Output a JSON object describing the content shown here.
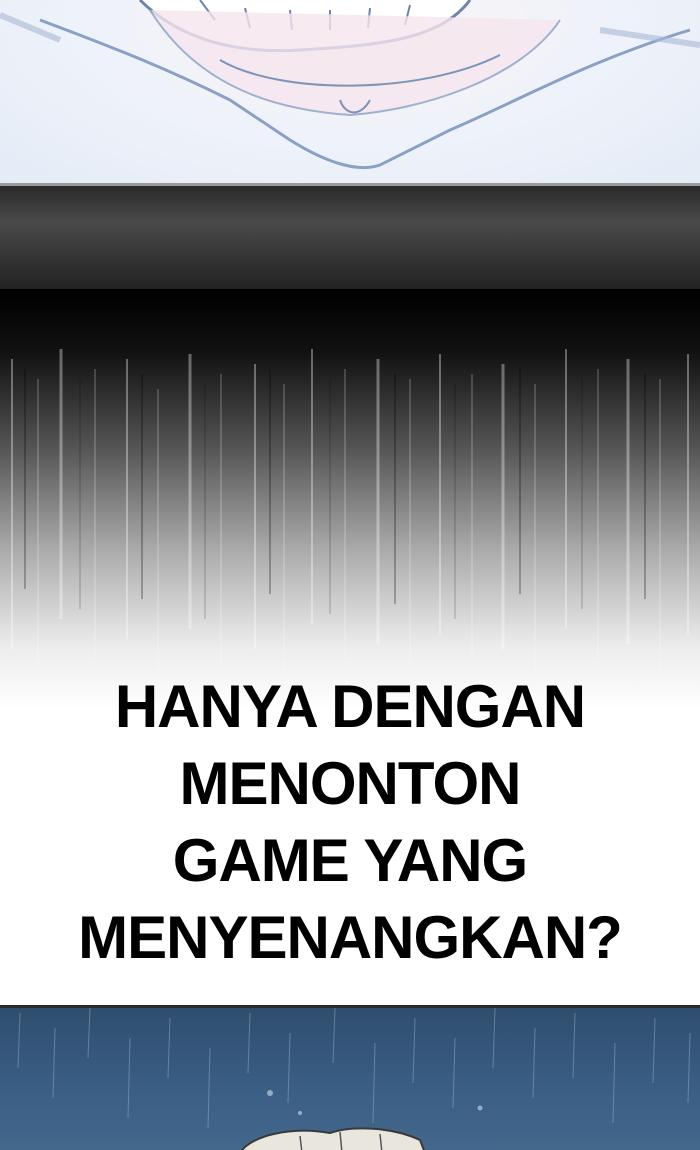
{
  "caption": {
    "lines": [
      "HANYA DENGAN",
      "MENONTON",
      "GAME YANG",
      "MENYENANGKAN?"
    ]
  }
}
